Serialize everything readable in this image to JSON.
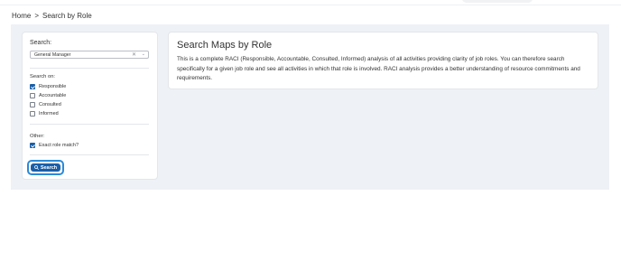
{
  "breadcrumb": {
    "home": "Home",
    "separator": ">",
    "current": "Search by Role"
  },
  "search_panel": {
    "search_label": "Search:",
    "role_select": {
      "value": "General Manager",
      "clear_glyph": "✕",
      "chevron_glyph": "⌄"
    },
    "search_on_label": "Search on:",
    "options": [
      {
        "label": "Responsible",
        "checked": true
      },
      {
        "label": "Accountable",
        "checked": false
      },
      {
        "label": "Consulted",
        "checked": false
      },
      {
        "label": "Informed",
        "checked": false
      }
    ],
    "other_label": "Other:",
    "exact_match": {
      "label": "Exact role match?",
      "checked": true
    },
    "search_button_label": "Search"
  },
  "info_card": {
    "title": "Search Maps by Role",
    "body": "This is a complete RACI (Responsible, Accountable, Consulted, Informed) analysis of all activities providing clarity of job roles. You can therefore search specifically for a given job role and see all activities in which that role is involved. RACI analysis provides a better understanding of resource commitments and requirements."
  },
  "colors": {
    "accent": "#1a5fa8",
    "focus_ring": "#2b8ad8",
    "canvas_bg": "#eef1f5"
  }
}
